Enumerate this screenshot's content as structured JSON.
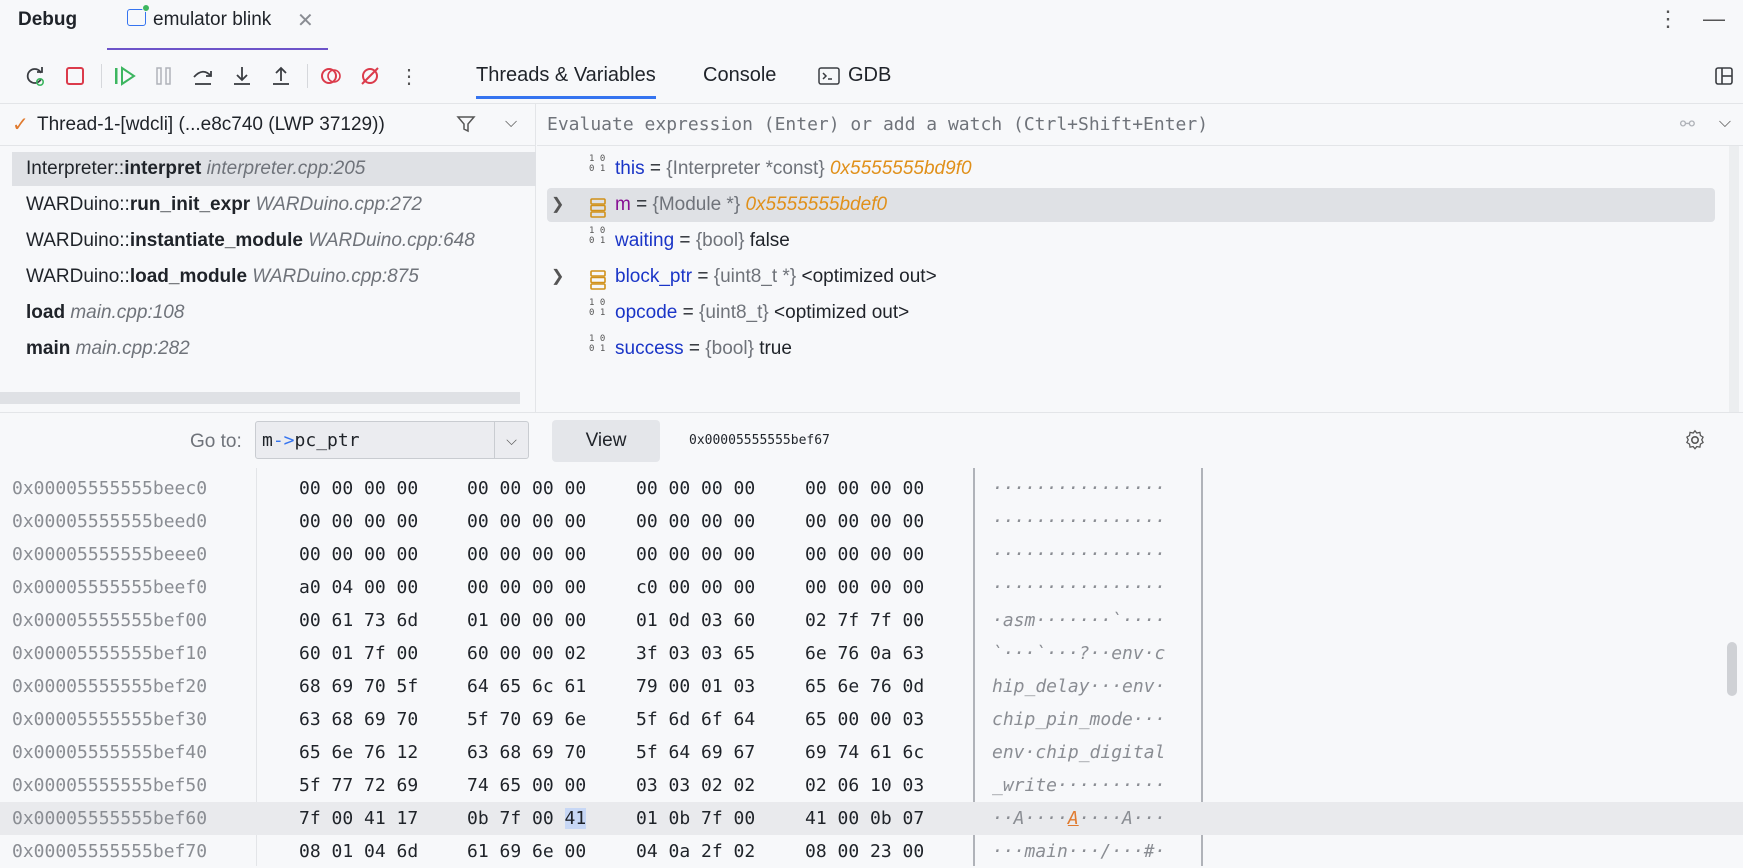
{
  "header": {
    "debug_title": "Debug",
    "session_tab": "emulator blink",
    "close_glyph": "✕",
    "more_glyph": "⋮",
    "minimize_glyph": "—"
  },
  "toolbar": {
    "icons": [
      "rerun-icon",
      "stop-icon",
      "resume-icon",
      "pause-icon",
      "step-over-icon",
      "step-into-icon",
      "step-out-icon",
      "view-breakpoints-icon",
      "mute-breakpoints-icon",
      "more-icon"
    ],
    "tabs": [
      {
        "label": "Threads & Variables",
        "active": true
      },
      {
        "label": "Console",
        "active": false
      },
      {
        "label": "GDB",
        "active": false
      }
    ]
  },
  "threads": {
    "selected_thread": "Thread-1-[wdcli] (...e8c740 (LWP 37129))",
    "frames": [
      {
        "prefix": "Interpreter::",
        "func": "interpret",
        "loc": "interpreter.cpp:205",
        "selected": true
      },
      {
        "prefix": "WARDuino::",
        "func": "run_init_expr",
        "loc": "WARDuino.cpp:272",
        "selected": false
      },
      {
        "prefix": "WARDuino::",
        "func": "instantiate_module",
        "loc": "WARDuino.cpp:648",
        "selected": false
      },
      {
        "prefix": "WARDuino::",
        "func": "load_module",
        "loc": "WARDuino.cpp:875",
        "selected": false
      },
      {
        "prefix": "",
        "func": "load",
        "loc": "main.cpp:108",
        "selected": false
      },
      {
        "prefix": "",
        "func": "main",
        "loc": "main.cpp:282",
        "selected": false
      }
    ]
  },
  "variables": {
    "eval_placeholder": "Evaluate expression (Enter) or add a watch (Ctrl+Shift+Enter)",
    "items": [
      {
        "name": "this",
        "eq": " = ",
        "type": "{Interpreter *const}",
        "value": "0x5555555bd9f0",
        "kind": "primitive",
        "expandable": false,
        "selected": false
      },
      {
        "name": "m",
        "eq": " = ",
        "type": "{Module *}",
        "value": "0x5555555bdef0",
        "kind": "struct",
        "expandable": true,
        "selected": true
      },
      {
        "name": "waiting",
        "eq": " = ",
        "type": "{bool}",
        "value": "false",
        "kind": "primitive",
        "expandable": false,
        "selected": false
      },
      {
        "name": "block_ptr",
        "eq": " = ",
        "type": "{uint8_t *}",
        "value": "<optimized out>",
        "kind": "struct",
        "expandable": true,
        "selected": false
      },
      {
        "name": "opcode",
        "eq": " = ",
        "type": "{uint8_t}",
        "value": "<optimized out>",
        "kind": "primitive",
        "expandable": false,
        "selected": false
      },
      {
        "name": "success",
        "eq": " = ",
        "type": "{bool}",
        "value": "true",
        "kind": "primitive",
        "expandable": false,
        "selected": false
      }
    ]
  },
  "memory": {
    "goto_label": "Go to:",
    "goto_value_a": "m",
    "goto_value_op": "->",
    "goto_value_b": "pc_ptr",
    "view_label": "View",
    "current_address": "0x00005555555bef67",
    "rows": [
      {
        "addr": "0x00005555555beec0",
        "groups": [
          "00 00 00 00",
          "00 00 00 00",
          "00 00 00 00",
          "00 00 00 00"
        ],
        "ascii": "················"
      },
      {
        "addr": "0x00005555555beed0",
        "groups": [
          "00 00 00 00",
          "00 00 00 00",
          "00 00 00 00",
          "00 00 00 00"
        ],
        "ascii": "················"
      },
      {
        "addr": "0x00005555555beee0",
        "groups": [
          "00 00 00 00",
          "00 00 00 00",
          "00 00 00 00",
          "00 00 00 00"
        ],
        "ascii": "················"
      },
      {
        "addr": "0x00005555555beef0",
        "groups": [
          "a0 04 00 00",
          "00 00 00 00",
          "c0 00 00 00",
          "00 00 00 00"
        ],
        "ascii": "················"
      },
      {
        "addr": "0x00005555555bef00",
        "groups": [
          "00 61 73 6d",
          "01 00 00 00",
          "01 0d 03 60",
          "02 7f 7f 00"
        ],
        "ascii": "·asm·······`····"
      },
      {
        "addr": "0x00005555555bef10",
        "groups": [
          "60 01 7f 00",
          "60 00 00 02",
          "3f 03 03 65",
          "6e 76 0a 63"
        ],
        "ascii": "`···`···?··env·c"
      },
      {
        "addr": "0x00005555555bef20",
        "groups": [
          "68 69 70 5f",
          "64 65 6c 61",
          "79 00 01 03",
          "65 6e 76 0d"
        ],
        "ascii": "hip_delay···env·"
      },
      {
        "addr": "0x00005555555bef30",
        "groups": [
          "63 68 69 70",
          "5f 70 69 6e",
          "5f 6d 6f 64",
          "65 00 00 03"
        ],
        "ascii": "chip_pin_mode···"
      },
      {
        "addr": "0x00005555555bef40",
        "groups": [
          "65 6e 76 12",
          "63 68 69 70",
          "5f 64 69 67",
          "69 74 61 6c"
        ],
        "ascii": "env·chip_digital"
      },
      {
        "addr": "0x00005555555bef50",
        "groups": [
          "5f 77 72 69",
          "74 65 00 00",
          "03 03 02 02",
          "02 06 10 03"
        ],
        "ascii": "_write··········"
      },
      {
        "addr": "0x00005555555bef60",
        "groups": [
          "7f 00 41 17",
          "0b 7f 00 41",
          "01 0b 7f 00",
          "41 00 0b 07"
        ],
        "ascii": "··A····A····A···",
        "highlight": true,
        "sel_group": 1,
        "sel_pre": "0b 7f 00 ",
        "sel_byte": "41",
        "ascii_pre": "··A····",
        "ascii_cur": "A",
        "ascii_post": "····A···"
      },
      {
        "addr": "0x00005555555bef70",
        "groups": [
          "08 01 04 6d",
          "61 69 6e 00",
          "04 0a 2f 02",
          "08 00 23 00"
        ],
        "ascii": "···main···/···#·"
      }
    ]
  }
}
